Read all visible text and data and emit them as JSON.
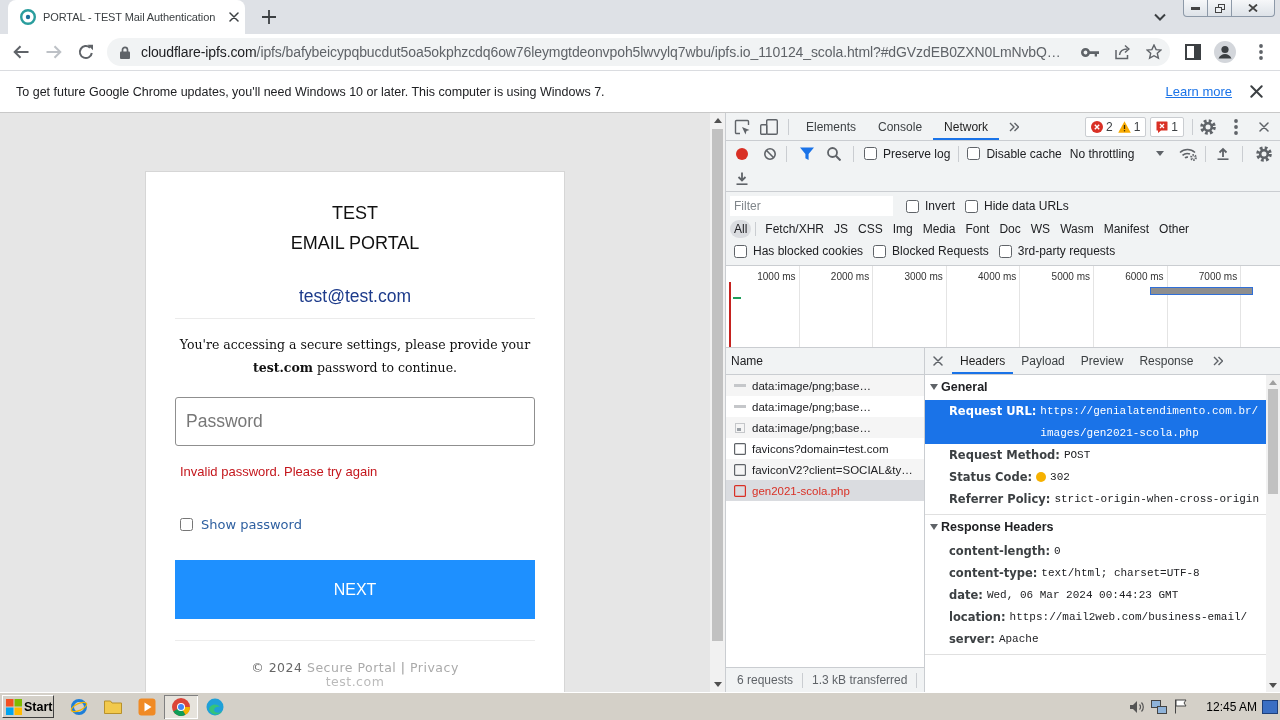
{
  "browser": {
    "tabs": [
      {
        "title": "PORTAL - TEST Mail Authentication",
        "selected": true
      }
    ],
    "navigation": {
      "back_disabled": false,
      "forward_disabled": true
    },
    "address": {
      "domain": "cloudflare-ipfs.com",
      "path": "/ipfs/bafybeicypqbucdut5oa5okphzcdq6ow76leymgtdeonvpoh5lwvylq7wbu/ipfs.io_110124_scola.html?#dGVzdEB0ZXN0LmNvbQ…"
    },
    "infobar": {
      "message": "To get future Google Chrome updates, you'll need Windows 10 or later. This computer is using Windows 7.",
      "link": "Learn more"
    }
  },
  "page": {
    "title": "TEST\nEMAIL PORTAL",
    "email": "test@test.com",
    "message": "You're accessing a secure settings, please provide your **test.com** password to continue.",
    "password": {
      "placeholder": "Password"
    },
    "error": "Invalid password. Please try again",
    "show_password": {
      "label": "Show password",
      "checked": false
    },
    "submit": "NEXT",
    "footer": {
      "copyright": "© 2024",
      "links": [
        "Secure Portal",
        "Privacy"
      ],
      "separator": "|",
      "domain": "test.com"
    }
  },
  "devtools": {
    "tabs": [
      {
        "label": "Elements",
        "selected": false
      },
      {
        "label": "Console",
        "selected": false
      },
      {
        "label": "Network",
        "selected": true
      }
    ],
    "errors": "2",
    "warnings": "1",
    "issues": "1",
    "recording": true,
    "filter_active": true,
    "preserve_log": {
      "label": "Preserve log",
      "checked": false
    },
    "disable_cache": {
      "label": "Disable cache",
      "checked": false
    },
    "throttling": "No throttling",
    "filter": {
      "placeholder": "Filter"
    },
    "invert": {
      "label": "Invert",
      "checked": false
    },
    "hide_data_urls": {
      "label": "Hide data URLs",
      "checked": false
    },
    "types": [
      {
        "label": "All",
        "selected": true
      },
      {
        "label": "Fetch/XHR",
        "selected": false
      },
      {
        "label": "JS",
        "selected": false
      },
      {
        "label": "CSS",
        "selected": false
      },
      {
        "label": "Img",
        "selected": false
      },
      {
        "label": "Media",
        "selected": false
      },
      {
        "label": "Font",
        "selected": false
      },
      {
        "label": "Doc",
        "selected": false
      },
      {
        "label": "WS",
        "selected": false
      },
      {
        "label": "Wasm",
        "selected": false
      },
      {
        "label": "Manifest",
        "selected": false
      },
      {
        "label": "Other",
        "selected": false
      }
    ],
    "more_filters": [
      {
        "label": "Has blocked cookies",
        "checked": false
      },
      {
        "label": "Blocked Requests",
        "checked": false
      },
      {
        "label": "3rd-party requests",
        "checked": false
      }
    ],
    "overview_ticks": [
      "1000 ms",
      "2000 ms",
      "3000 ms",
      "4000 ms",
      "5000 ms",
      "6000 ms",
      "7000 ms"
    ],
    "name_column": "Name",
    "requests": [
      {
        "name": "data:image/png;base…",
        "kind": "image",
        "selected": false,
        "failed": false
      },
      {
        "name": "data:image/png;base…",
        "kind": "image",
        "selected": false,
        "failed": false
      },
      {
        "name": "data:image/png;base…",
        "kind": "thumbnail",
        "selected": false,
        "failed": false
      },
      {
        "name": "favicons?domain=test.com",
        "kind": "document",
        "selected": false,
        "failed": false
      },
      {
        "name": "faviconV2?client=SOCIAL&ty…",
        "kind": "document",
        "selected": false,
        "failed": false
      },
      {
        "name": "gen2021-scola.php",
        "kind": "document",
        "selected": true,
        "failed": true
      }
    ],
    "summary": [
      "6 requests",
      "1.3 kB transferred"
    ],
    "detail_tabs": [
      {
        "label": "Headers",
        "selected": true
      },
      {
        "label": "Payload",
        "selected": false
      },
      {
        "label": "Preview",
        "selected": false
      },
      {
        "label": "Response",
        "selected": false
      }
    ],
    "sections": [
      {
        "title": "General",
        "expanded": true,
        "rows": [
          {
            "name": "Request URL:",
            "value": "https://genialatendimento.com.br/images/gen2021-scola.php",
            "kind": "plain",
            "selected": true
          },
          {
            "name": "Request Method:",
            "value": "POST",
            "kind": "plain",
            "selected": false
          },
          {
            "name": "Status Code:",
            "value": "302",
            "kind": "status",
            "selected": false
          },
          {
            "name": "Referrer Policy:",
            "value": "strict-origin-when-cross-origin",
            "kind": "plain",
            "selected": false
          }
        ]
      },
      {
        "title": "Response Headers",
        "expanded": true,
        "rows": [
          {
            "name": "content-length:",
            "value": "0",
            "kind": "plain",
            "selected": false
          },
          {
            "name": "content-type:",
            "value": "text/html; charset=UTF-8",
            "kind": "plain",
            "selected": false
          },
          {
            "name": "date:",
            "value": "Wed, 06 Mar 2024 00:44:23 GMT",
            "kind": "plain",
            "selected": false
          },
          {
            "name": "location:",
            "value": "https://mail2web.com/business-email/",
            "kind": "plain",
            "selected": false
          },
          {
            "name": "server:",
            "value": "Apache",
            "kind": "plain",
            "selected": false
          }
        ]
      }
    ]
  },
  "taskbar": {
    "start": "Start",
    "buttons": [
      {
        "kind": "e-logo",
        "selected": false
      },
      {
        "kind": "folder",
        "selected": false
      },
      {
        "kind": "play",
        "selected": false
      },
      {
        "kind": "ring",
        "selected": true
      },
      {
        "kind": "swirl",
        "selected": false
      }
    ],
    "clock": "12:45 AM"
  }
}
